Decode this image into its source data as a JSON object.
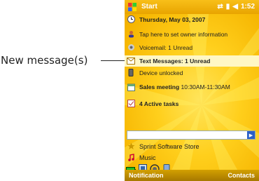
{
  "callout": {
    "text": "New message(s)"
  },
  "titlebar": {
    "start_label": "Start",
    "time": "1:52"
  },
  "items": [
    {
      "text": "Thursday, May 03, 2007"
    },
    {
      "text": "Tap here to set owner information"
    },
    {
      "text": "Voicemail: 1 Unread"
    },
    {
      "text": "Text Messages: 1 Unread"
    },
    {
      "text": "Device unlocked"
    },
    {
      "title": "Sales meeting",
      "subtitle": "10:30AM-11:30AM"
    },
    {
      "text": "4 Active tasks"
    }
  ],
  "search": {
    "placeholder": "",
    "go_label": "▶"
  },
  "apps": [
    {
      "text": "Sprint Software Store"
    },
    {
      "text": "Music"
    }
  ],
  "softkeys": {
    "left": "Notification",
    "right": "Contacts"
  },
  "colors": {
    "accent": "#f5b400",
    "selection": "#fff7c4",
    "softbar": "#b88500"
  }
}
